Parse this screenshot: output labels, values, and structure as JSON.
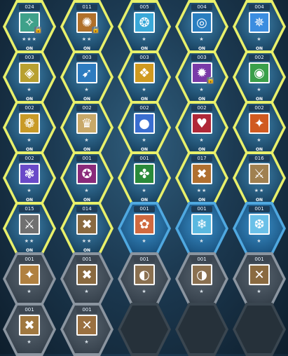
{
  "colors": {
    "on_border": "#e8f06a",
    "blue_border": "#4fa8e0",
    "gray_border": "#8b95a0",
    "empty_border": "#3a4650"
  },
  "cores": [
    {
      "level": "024",
      "icon": "compass-rune-icon",
      "glyph": "✧",
      "color": "#3fa18a",
      "stars": "★★★",
      "locked": true,
      "on": "ON",
      "tier": "on"
    },
    {
      "level": "011",
      "icon": "sun-rune-icon",
      "glyph": "✺",
      "color": "#b0702a",
      "stars": "★★",
      "locked": true,
      "on": "ON",
      "tier": "on"
    },
    {
      "level": "005",
      "icon": "wind-spirit-icon",
      "glyph": "❂",
      "color": "#3aa8d8",
      "stars": "★",
      "locked": false,
      "on": "ON",
      "tier": "on"
    },
    {
      "level": "004",
      "icon": "portal-ring-icon",
      "glyph": "◎",
      "color": "#2a7ec0",
      "stars": "★",
      "locked": false,
      "on": "ON",
      "tier": "on"
    },
    {
      "level": "004",
      "icon": "wing-burst-icon",
      "glyph": "✵",
      "color": "#3b8de0",
      "stars": "★",
      "locked": false,
      "on": "ON",
      "tier": "on"
    },
    {
      "level": "003",
      "icon": "gold-emblem-icon",
      "glyph": "◈",
      "color": "#b8a030",
      "stars": "★",
      "locked": false,
      "on": "ON",
      "tier": "on"
    },
    {
      "level": "003",
      "icon": "dash-figure-icon",
      "glyph": "➹",
      "color": "#2e7cc0",
      "stars": "★",
      "locked": false,
      "on": "ON",
      "tier": "on"
    },
    {
      "level": "003",
      "icon": "golden-sigil-icon",
      "glyph": "❖",
      "color": "#d09a20",
      "stars": "★",
      "locked": false,
      "on": "ON",
      "tier": "on"
    },
    {
      "level": "003",
      "icon": "purple-vortex-icon",
      "glyph": "✹",
      "color": "#7a3aa8",
      "stars": "★",
      "locked": true,
      "on": "ON",
      "tier": "on"
    },
    {
      "level": "002",
      "icon": "green-eye-icon",
      "glyph": "◉",
      "color": "#3aa04a",
      "stars": "★",
      "locked": false,
      "on": "ON",
      "tier": "on"
    },
    {
      "level": "002",
      "icon": "gold-ring-icon",
      "glyph": "❁",
      "color": "#c89a28",
      "stars": "★",
      "locked": false,
      "on": "ON",
      "tier": "on"
    },
    {
      "level": "002",
      "icon": "goddess-icon",
      "glyph": "♛",
      "color": "#c8a868",
      "stars": "★",
      "locked": false,
      "on": "ON",
      "tier": "on"
    },
    {
      "level": "002",
      "icon": "blue-orb-icon",
      "glyph": "●",
      "color": "#3a6ed0",
      "stars": "★",
      "locked": false,
      "on": "ON",
      "tier": "on"
    },
    {
      "level": "002",
      "icon": "red-heart-icon",
      "glyph": "♥",
      "color": "#b02838",
      "stars": "★",
      "locked": false,
      "on": "ON",
      "tier": "on"
    },
    {
      "level": "002",
      "icon": "fire-fan-icon",
      "glyph": "✦",
      "color": "#d05a20",
      "stars": "★",
      "locked": false,
      "on": "ON",
      "tier": "on"
    },
    {
      "level": "002",
      "icon": "crystal-flower-icon",
      "glyph": "❃",
      "color": "#6a4ac8",
      "stars": "★",
      "locked": false,
      "on": "ON",
      "tier": "on"
    },
    {
      "level": "001",
      "icon": "dark-eye-icon",
      "glyph": "✪",
      "color": "#8a2a7a",
      "stars": "★",
      "locked": false,
      "on": "ON",
      "tier": "on"
    },
    {
      "level": "001",
      "icon": "green-gem-icon",
      "glyph": "✤",
      "color": "#2a8a3a",
      "stars": "★",
      "locked": false,
      "on": "ON",
      "tier": "on"
    },
    {
      "level": "017",
      "icon": "boost-rune-icon",
      "glyph": "✖",
      "color": "#b07030",
      "stars": "★★",
      "locked": false,
      "on": "ON",
      "tier": "on"
    },
    {
      "level": "016",
      "icon": "crossed-weapons-icon",
      "glyph": "⚔",
      "color": "#a08050",
      "stars": "★★",
      "locked": false,
      "on": "ON",
      "tier": "on"
    },
    {
      "level": "015",
      "icon": "sword-slash-icon",
      "glyph": "⚔",
      "color": "#707070",
      "stars": "★★",
      "locked": false,
      "on": "ON",
      "tier": "on"
    },
    {
      "level": "014",
      "icon": "claw-strike-icon",
      "glyph": "✖",
      "color": "#8a6a40",
      "stars": "★★",
      "locked": false,
      "on": "ON",
      "tier": "on"
    },
    {
      "level": "001",
      "icon": "fox-spirit-icon",
      "glyph": "✿",
      "color": "#d06a40",
      "stars": "★",
      "locked": false,
      "on": "",
      "tier": "blue"
    },
    {
      "level": "001",
      "icon": "ice-crystal-icon",
      "glyph": "❄",
      "color": "#5ab8e0",
      "stars": "★",
      "locked": false,
      "on": "",
      "tier": "blue"
    },
    {
      "level": "001",
      "icon": "frost-lotus-icon",
      "glyph": "❆",
      "color": "#6ac0e8",
      "stars": "★",
      "locked": false,
      "on": "",
      "tier": "blue"
    },
    {
      "level": "001",
      "icon": "arrow-rune-icon",
      "glyph": "✦",
      "color": "#b08040",
      "stars": "★",
      "locked": false,
      "on": "",
      "tier": "gray"
    },
    {
      "level": "001",
      "icon": "spear-rune-icon",
      "glyph": "✖",
      "color": "#8a6a40",
      "stars": "★",
      "locked": false,
      "on": "",
      "tier": "gray"
    },
    {
      "level": "001",
      "icon": "shield-rune-icon",
      "glyph": "◐",
      "color": "#8a7050",
      "stars": "★",
      "locked": false,
      "on": "",
      "tier": "gray"
    },
    {
      "level": "001",
      "icon": "orb-rune-icon",
      "glyph": "◑",
      "color": "#8a7050",
      "stars": "★",
      "locked": false,
      "on": "",
      "tier": "gray"
    },
    {
      "level": "001",
      "icon": "blade-rune-icon",
      "glyph": "✕",
      "color": "#8a6a40",
      "stars": "★",
      "locked": false,
      "on": "",
      "tier": "gray"
    },
    {
      "level": "001",
      "icon": "axe-rune-icon",
      "glyph": "✖",
      "color": "#a07840",
      "stars": "★",
      "locked": false,
      "on": "",
      "tier": "gray"
    },
    {
      "level": "001",
      "icon": "hammer-rune-icon",
      "glyph": "✕",
      "color": "#9a7040",
      "stars": "★",
      "locked": false,
      "on": "",
      "tier": "gray"
    },
    {
      "level": "",
      "icon": "",
      "glyph": "",
      "color": "",
      "stars": "",
      "locked": false,
      "on": "",
      "tier": "empty"
    },
    {
      "level": "",
      "icon": "",
      "glyph": "",
      "color": "",
      "stars": "",
      "locked": false,
      "on": "",
      "tier": "empty"
    },
    {
      "level": "",
      "icon": "",
      "glyph": "",
      "color": "",
      "stars": "",
      "locked": false,
      "on": "",
      "tier": "empty"
    }
  ]
}
